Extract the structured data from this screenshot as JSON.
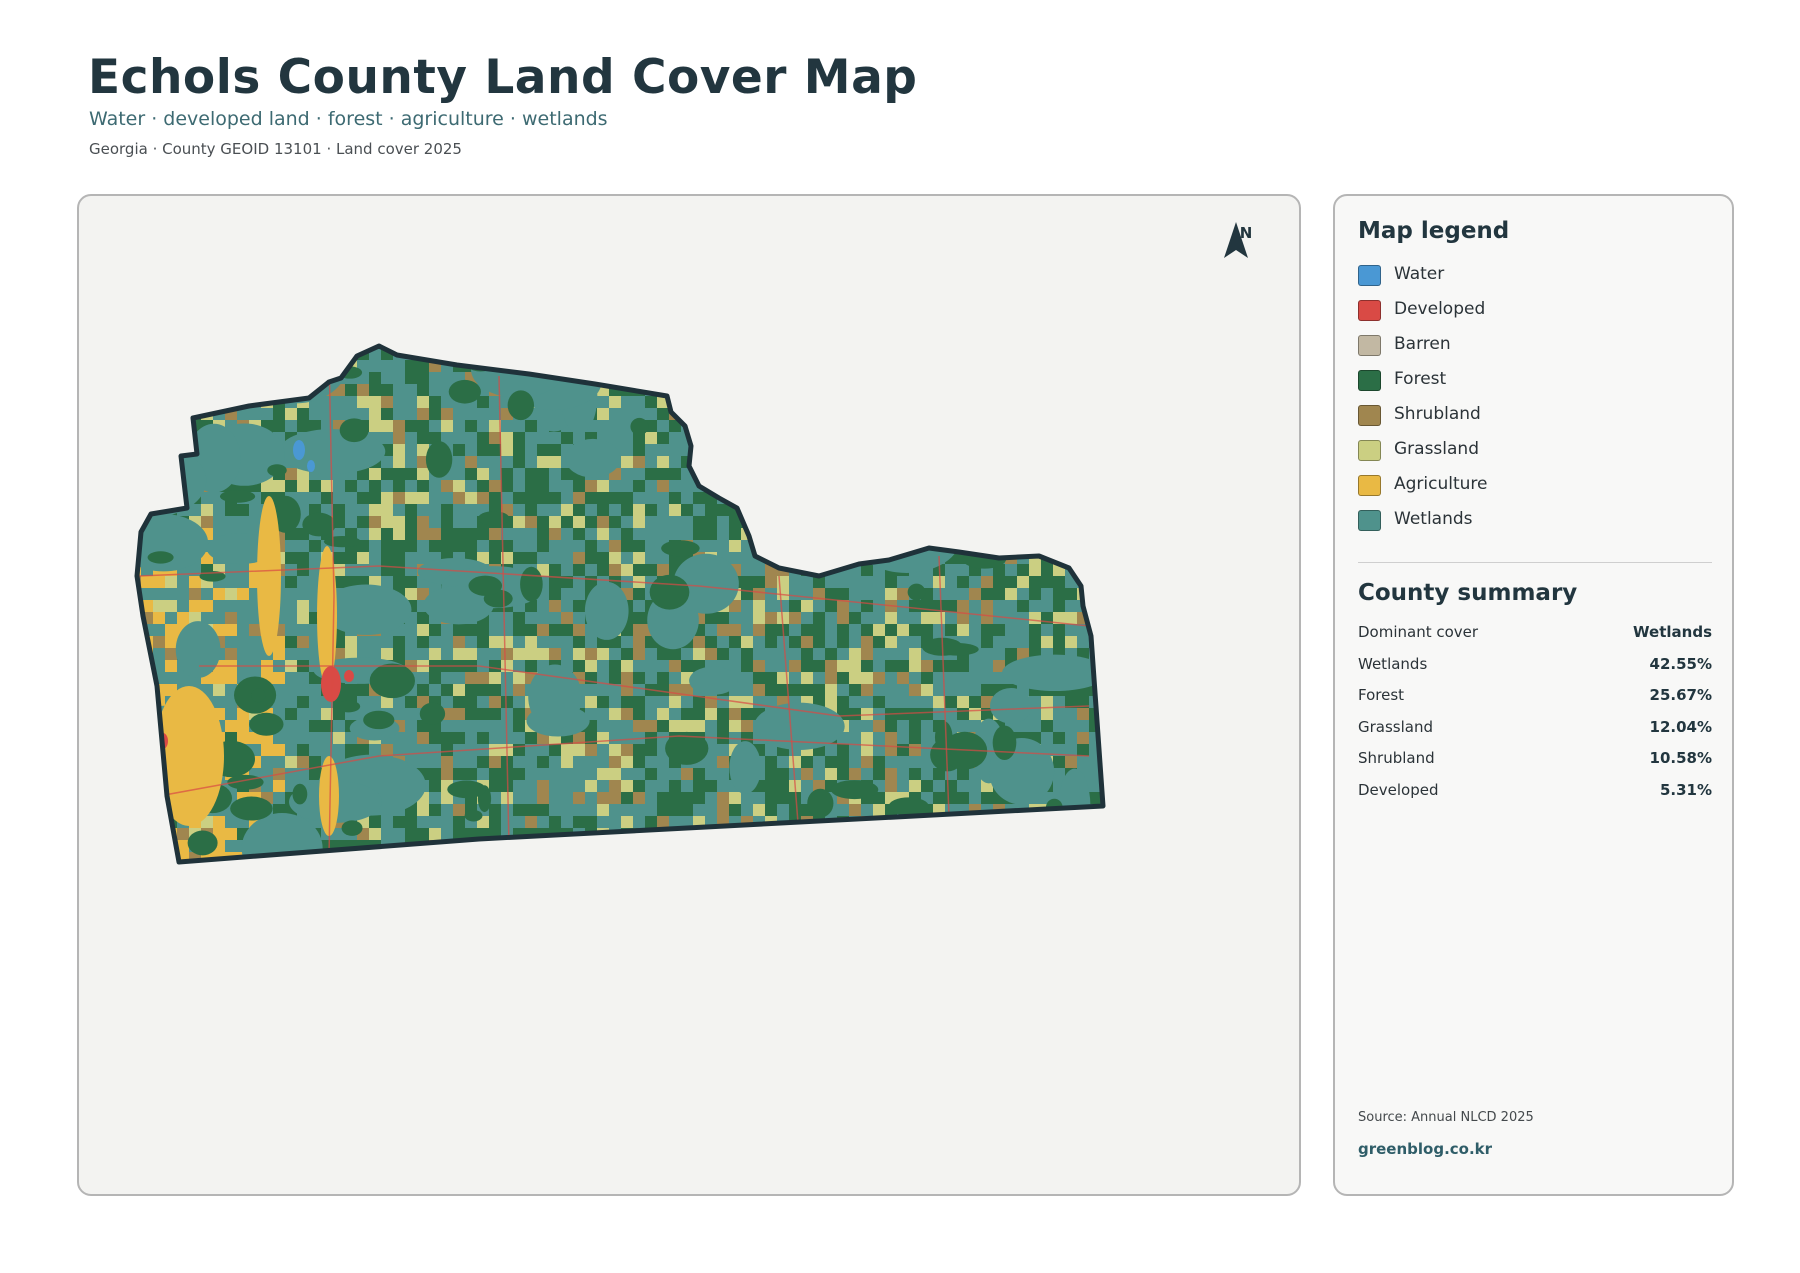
{
  "header": {
    "title": "Echols County Land Cover Map",
    "subtitle": "Water · developed land · forest · agriculture · wetlands",
    "meta": "Georgia · County GEOID 13101 · Land cover 2025"
  },
  "map": {
    "north_label": "N",
    "colors": {
      "water": "#4a98d4",
      "developed": "#d94a45",
      "barren": "#c2b8a3",
      "forest": "#2b6e46",
      "shrubland": "#a0864f",
      "grassland": "#cbcf82",
      "agriculture": "#e9b944",
      "wetlands": "#4f928c",
      "outline": "#1f323a"
    }
  },
  "legend": {
    "title": "Map legend",
    "items": [
      {
        "label": "Water",
        "color": "#4a98d4"
      },
      {
        "label": "Developed",
        "color": "#d94a45"
      },
      {
        "label": "Barren",
        "color": "#c2b8a3"
      },
      {
        "label": "Forest",
        "color": "#2b6e46"
      },
      {
        "label": "Shrubland",
        "color": "#a0864f"
      },
      {
        "label": "Grassland",
        "color": "#cbcf82"
      },
      {
        "label": "Agriculture",
        "color": "#e9b944"
      },
      {
        "label": "Wetlands",
        "color": "#4f928c"
      }
    ]
  },
  "summary": {
    "title": "County summary",
    "rows": [
      {
        "label": "Dominant cover",
        "value": "Wetlands"
      },
      {
        "label": "Wetlands",
        "value": "42.55%"
      },
      {
        "label": "Forest",
        "value": "25.67%"
      },
      {
        "label": "Grassland",
        "value": "12.04%"
      },
      {
        "label": "Shrubland",
        "value": "10.58%"
      },
      {
        "label": "Developed",
        "value": "5.31%"
      }
    ]
  },
  "footer": {
    "source": "Source: Annual NLCD 2025",
    "brand": "greenblog.co.kr"
  }
}
